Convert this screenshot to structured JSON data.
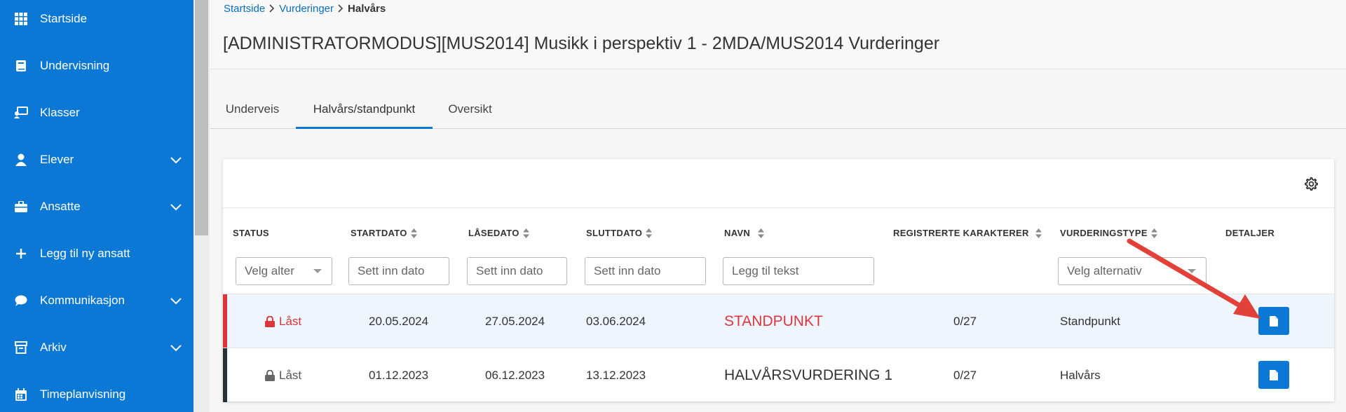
{
  "sidebar": {
    "items": [
      {
        "label": "Startside",
        "icon": "grid-icon",
        "expandable": false
      },
      {
        "label": "Undervisning",
        "icon": "book-icon",
        "expandable": false
      },
      {
        "label": "Klasser",
        "icon": "classroom-icon",
        "expandable": false
      },
      {
        "label": "Elever",
        "icon": "student-icon",
        "expandable": true
      },
      {
        "label": "Ansatte",
        "icon": "briefcase-icon",
        "expandable": true
      },
      {
        "label": "Legg til ny ansatt",
        "icon": "plus-icon",
        "expandable": false
      },
      {
        "label": "Kommunikasjon",
        "icon": "chat-icon",
        "expandable": true
      },
      {
        "label": "Arkiv",
        "icon": "archive-icon",
        "expandable": true
      },
      {
        "label": "Timeplanvisning",
        "icon": "calendar-icon",
        "expandable": false
      }
    ]
  },
  "breadcrumb": {
    "items": [
      "Startside",
      "Vurderinger"
    ],
    "current": "Halvårs"
  },
  "page_title": "[ADMINISTRATORMODUS][MUS2014] Musikk i perspektiv 1 - 2MDA/MUS2014 Vurderinger",
  "tabs": [
    {
      "label": "Underveis",
      "active": false
    },
    {
      "label": "Halvårs/standpunkt",
      "active": true
    },
    {
      "label": "Oversikt",
      "active": false
    }
  ],
  "table": {
    "headers": {
      "status": "STATUS",
      "startdato": "STARTDATO",
      "lasedato": "LÅSEDATO",
      "sluttdato": "SLUTTDATO",
      "navn": "NAVN",
      "registrerte": "REGISTRERTE KARAKTERER",
      "vurderingstype": "VURDERINGSTYPE",
      "detaljer": "DETALJER"
    },
    "filters": {
      "status": "Velg alter",
      "startdato": "Sett inn dato",
      "lasedato": "Sett inn dato",
      "sluttdato": "Sett inn dato",
      "navn": "Legg til tekst",
      "vurderingstype": "Velg alternativ"
    },
    "rows": [
      {
        "status": "Låst",
        "startdato": "20.05.2024",
        "lasedato": "27.05.2024",
        "sluttdato": "03.06.2024",
        "navn": "STANDPUNKT",
        "registrerte": "0/27",
        "vurderingstype": "Standpunkt",
        "accent": "#d9363e",
        "highlight": true
      },
      {
        "status": "Låst",
        "startdato": "01.12.2023",
        "lasedato": "06.12.2023",
        "sluttdato": "13.12.2023",
        "navn": "HALVÅRSVURDERING 1",
        "registrerte": "0/27",
        "vurderingstype": "Halvårs",
        "accent": "#263238",
        "highlight": false
      }
    ]
  },
  "colors": {
    "sidebar_bg": "#0a78d4",
    "primary": "#0a78d4",
    "locked_red": "#d9363e",
    "annotation_arrow": "#e2413a"
  }
}
